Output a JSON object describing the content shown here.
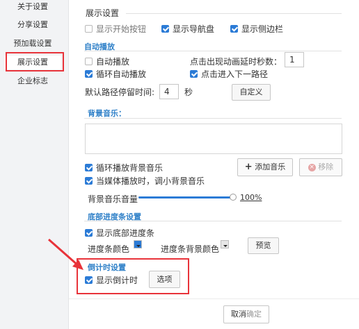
{
  "sidebar": {
    "items": [
      {
        "label": "关于设置"
      },
      {
        "label": "分享设置"
      },
      {
        "label": "预加载设置"
      },
      {
        "label": "展示设置"
      },
      {
        "label": "企业标志"
      }
    ]
  },
  "display": {
    "title": "展示设置",
    "show_start_button": "显示开始按钮",
    "show_navigation": "显示导航盘",
    "show_sidebar": "显示侧边栏"
  },
  "autoplay": {
    "title": "自动播放",
    "autoplay_label": "自动播放",
    "delay_label": "点击出现动画延时秒数：",
    "delay_value": "1",
    "loop_label": "循环自动播放",
    "next_path_label": "点击进入下一路径",
    "dwell_label": "默认路径停留时间:",
    "dwell_value": "4",
    "dwell_unit": "秒",
    "custom_button": "自定义"
  },
  "music": {
    "title": "背景音乐：",
    "loop_label": "循环播放背景音乐",
    "add_button": "添加音乐",
    "remove_button": "移除",
    "duck_label": "当媒体播放时，调小背景音乐",
    "volume_label": "背景音乐音量",
    "volume_value": "100%",
    "volume_level": 1.0
  },
  "progress": {
    "title": "底部进度条设置",
    "show_label": "显示底部进度条",
    "bar_color_label": "进度条颜色",
    "bg_color_label": "进度条背景颜色",
    "preview_button": "预览",
    "bar_color": "#2b7bd6",
    "bg_color": "#e6e6e6"
  },
  "countdown": {
    "title": "倒计时设置",
    "show_label": "显示倒计时",
    "options_button": "选项"
  },
  "footer": {
    "cancel_button": "取消",
    "confirm_button": "确定"
  },
  "colors": {
    "accent": "#2b7bd6",
    "highlight": "#e8333a"
  }
}
